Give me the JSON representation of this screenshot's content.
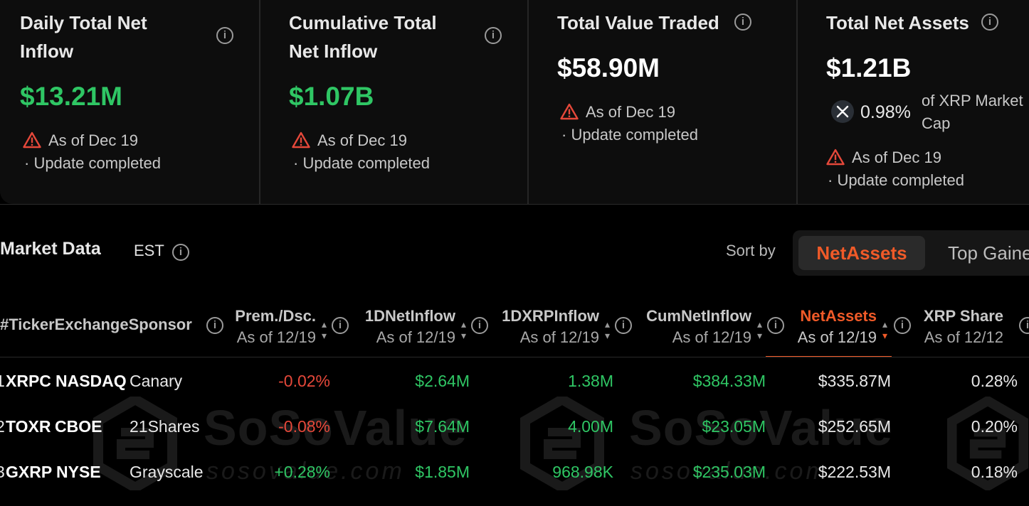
{
  "cards": [
    {
      "title_line1": "Daily Total Net",
      "title_line2": "Inflow",
      "value": "$13.21M",
      "as_of": "As of Dec 19",
      "status": "· Update completed"
    },
    {
      "title_line1": "Cumulative Total",
      "title_line2": "Net Inflow",
      "value": "$1.07B",
      "as_of": "As of Dec 19",
      "status": "· Update completed"
    },
    {
      "title_line1": "Total Value Traded",
      "value": "$58.90M",
      "as_of": "As of Dec 19",
      "status": "· Update completed"
    },
    {
      "title_line1": "Total Net Assets",
      "value": "$1.21B",
      "share_pct": "0.98%",
      "share_label_line1": "of XRP Market",
      "share_label_line2": "Cap",
      "as_of": "As of Dec 19",
      "status": "· Update completed"
    }
  ],
  "colors": {
    "green": "#2fc664",
    "red": "#e5483a",
    "accent": "#f05a28",
    "background": "#000000"
  },
  "market": {
    "title": "Market Data",
    "timezone": "EST",
    "sort_label": "Sort by",
    "sort_options": [
      "NetAssets",
      "Top Gaine"
    ],
    "active_sort": "NetAssets"
  },
  "table": {
    "headers": {
      "lead": "#TickerExchangeSponsor",
      "premium": {
        "title": "Prem./Dsc.",
        "sub": "As of 12/19"
      },
      "net_inflow": {
        "title": "1DNetInflow",
        "sub": "As of 12/19"
      },
      "xrp_inflow": {
        "title": "1DXRPInflow",
        "sub": "As of 12/19"
      },
      "cum_inflow": {
        "title": "CumNetInflow",
        "sub": "As of 12/19"
      },
      "net_assets": {
        "title": "NetAssets",
        "sub": "As of 12/19"
      },
      "xrp_share": {
        "title": "XRP Share",
        "sub": "As of 12/12"
      }
    },
    "rows": [
      {
        "rank": "1",
        "ticker": "XRPC",
        "exchange": "NASDAQ",
        "sponsor": "Canary",
        "premium": "-0.02%",
        "net_inflow": "$2.64M",
        "xrp_inflow": "1.38M",
        "cum_inflow": "$384.33M",
        "net_assets": "$335.87M",
        "xrp_share": "0.28%"
      },
      {
        "rank": "2",
        "ticker": "TOXR",
        "exchange": "CBOE",
        "sponsor": "21Shares",
        "premium": "-0.08%",
        "net_inflow": "$7.64M",
        "xrp_inflow": "4.00M",
        "cum_inflow": "$23.05M",
        "net_assets": "$252.65M",
        "xrp_share": "0.20%"
      },
      {
        "rank": "3",
        "ticker": "GXRP",
        "exchange": "NYSE",
        "sponsor": "Grayscale",
        "premium": "+0.28%",
        "net_inflow": "$1.85M",
        "xrp_inflow": "968.98K",
        "cum_inflow": "$235.03M",
        "net_assets": "$222.53M",
        "xrp_share": "0.18%"
      }
    ]
  },
  "watermark": {
    "brand": "SoSoValue",
    "domain": "sosovalue.com"
  },
  "icons": {
    "info": "info-icon",
    "warning": "warning-icon",
    "xrp": "xrp-logo-icon",
    "sort": "sort-icon"
  }
}
